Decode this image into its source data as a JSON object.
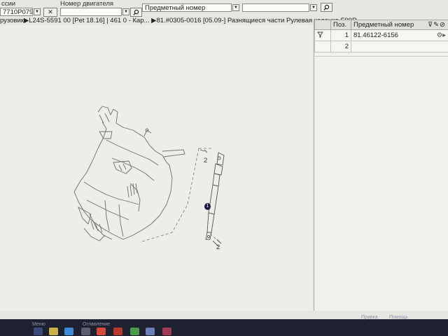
{
  "filter_bar": {
    "vehicle_label": "ссии",
    "vehicle_value": "7710P079",
    "engine_label": "Номер двигателя",
    "engine_value": "",
    "search_field_value": "Предметный номер",
    "search_field2_value": ""
  },
  "breadcrumb": {
    "text": "рузовик▶L24S-5591 00  [Pet 18.16]  | 461 0 - Кар... ▶81.#0305-0016 [05.09-] Разнящиеся части Рулевая колонка  F99R..."
  },
  "drawing": {
    "callouts": [
      "2",
      "1",
      "2"
    ]
  },
  "parts_table": {
    "headers": [
      "Поз.",
      "Предметный номер"
    ],
    "rows": [
      {
        "pos": "1",
        "number": "81.46122-6156"
      },
      {
        "pos": "2",
        "number": ""
      }
    ]
  },
  "taskbar": {
    "items": [
      "Меню",
      "Оглавление",
      "Правка",
      "Помощь"
    ]
  },
  "colors": {
    "background": "#e7e6e2",
    "taskbar": "#1d2130",
    "callout_highlight": "#1a1a40"
  }
}
